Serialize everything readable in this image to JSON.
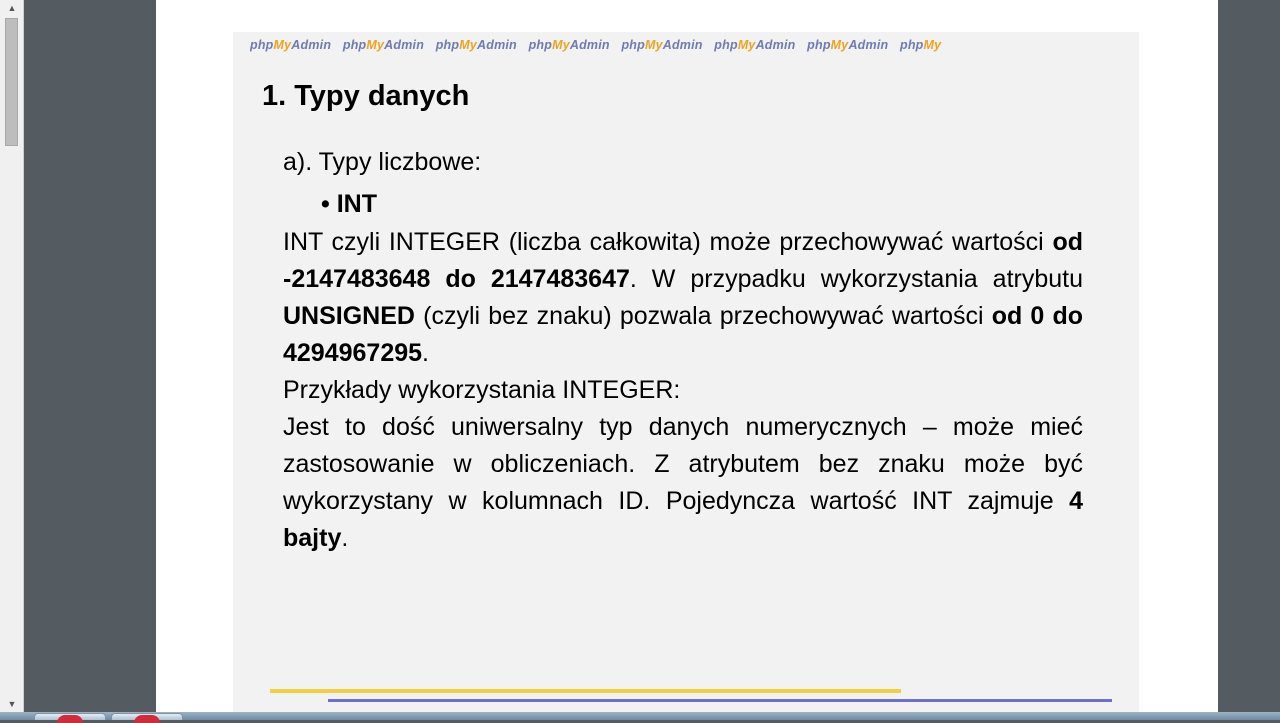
{
  "brand": {
    "repeats": [
      {
        "php": "php",
        "my": "My",
        "admin": "Admin"
      },
      {
        "php": "php",
        "my": "My",
        "admin": "Admin"
      },
      {
        "php": "php",
        "my": "My",
        "admin": "Admin"
      },
      {
        "php": "php",
        "my": "My",
        "admin": "Admin"
      },
      {
        "php": "php",
        "my": "My",
        "admin": "Admin"
      },
      {
        "php": "php",
        "my": "My",
        "admin": "Admin"
      },
      {
        "php": "php",
        "my": "My",
        "admin": "Admin"
      },
      {
        "php": "php",
        "my": "My",
        "admin": ""
      }
    ]
  },
  "slide": {
    "title": "1. Typy danych",
    "subhead": "a). Typy liczbowe:",
    "bullet_symbol": "•",
    "bullet_label": "INT",
    "p1": {
      "t1": "INT czyli INTEGER (liczba całkowita) może przechowywać wartości ",
      "b1": "od -2147483648 do 2147483647",
      "t2": ". W przypadku wykorzystania atrybutu ",
      "b2": "UNSIGNED",
      "t3": " (czyli bez znaku) pozwala przechowywać wartości ",
      "b3": "od 0 do 4294967295",
      "t4": "."
    },
    "p2": "Przykłady wykorzystania INTEGER:",
    "p3": {
      "t1": "Jest to dość uniwersalny typ danych numerycznych – może mieć zastosowanie w obliczeniach. Z atrybutem bez znaku może być wykorzystany w kolumnach ID. Pojedyncza wartość INT zajmuje ",
      "b1": "4 bajty",
      "t2": "."
    }
  },
  "colors": {
    "brand_php": "#6c7bb9",
    "brand_my": "#f2a31b",
    "line_yellow": "#f5cf3c",
    "line_blue": "#6b6fd0",
    "slide_bg": "#f2f2f2",
    "viewer_bg": "#545b61"
  },
  "icons": {
    "scroll_up": "scroll-up-arrow-icon",
    "scroll_down": "scroll-down-arrow-icon"
  }
}
